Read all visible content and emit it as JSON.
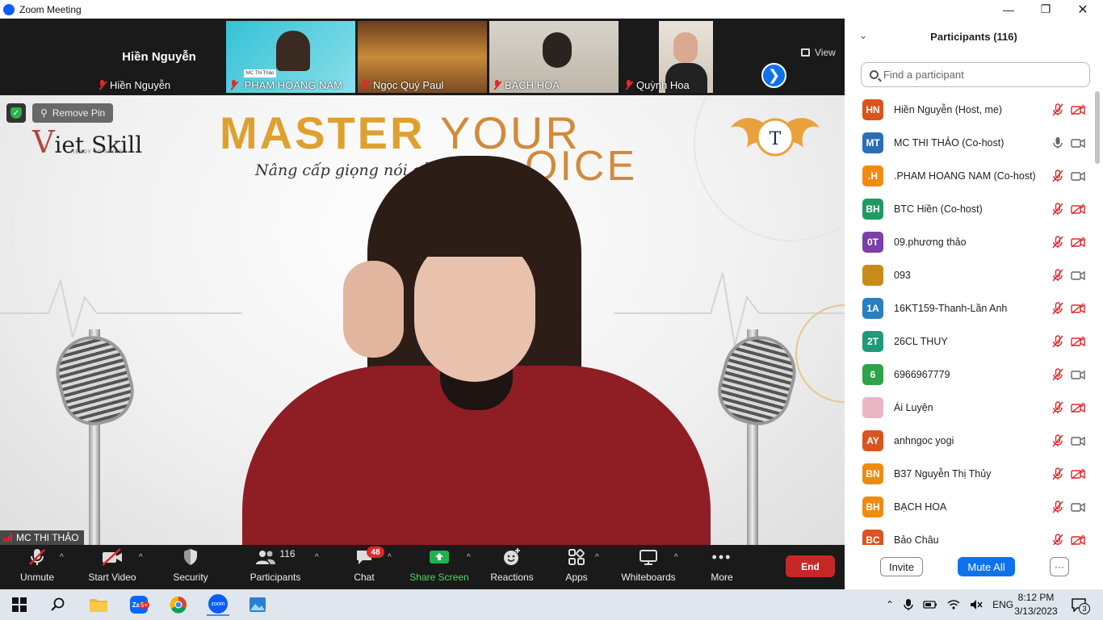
{
  "window": {
    "title": "Zoom Meeting"
  },
  "filmstrip": {
    "tiles": [
      {
        "name": "Hiền Nguyễn",
        "display_name": "Hiền Nguyễn"
      },
      {
        "name": ".PHAM HOANG NAM",
        "overlay_text": "MC Thi Thảo"
      },
      {
        "name": "Ngọc Quý Paul"
      },
      {
        "name": "BẠCH HOA"
      },
      {
        "name": "Quỳnh Hoa"
      }
    ],
    "view_label": "View"
  },
  "stage": {
    "brand": "iet Skill",
    "brand_letter": "V",
    "brand_sub": "READY TO SHINE !",
    "title_a": "MASTER ",
    "title_b": "YOUR",
    "title_c": "OICE",
    "subtitle": "Nâng cấp giọng nói của bạn",
    "remove_pin": "Remove Pin",
    "speaker_name": "MC THI THẢO"
  },
  "participants_panel": {
    "title": "Participants (116)",
    "search_placeholder": "Find a participant",
    "rows": [
      {
        "initials": "HN",
        "name": "Hiền Nguyễn (Host, me)",
        "color": "#d9541e",
        "mic": "muted",
        "cam": "off"
      },
      {
        "initials": "MT",
        "name": "MC THI THẢO (Co-host)",
        "color": "#2a6fb5",
        "mic": "on",
        "cam": "on"
      },
      {
        "initials": ".H",
        "name": ".PHAM HOANG NAM (Co-host)",
        "color": "#f08b12",
        "mic": "muted",
        "cam": "on"
      },
      {
        "initials": "BH",
        "name": "BTC Hiền (Co-host)",
        "color": "#1f9a63",
        "mic": "muted",
        "cam": "off"
      },
      {
        "initials": "0T",
        "name": "09.phương thảo",
        "color": "#7a3fa8",
        "mic": "muted",
        "cam": "off"
      },
      {
        "initials": "",
        "name": "093",
        "color": "#c98a1c",
        "mic": "muted",
        "cam": "on"
      },
      {
        "initials": "1A",
        "name": "16KT159-Thanh-Lần Anh",
        "color": "#2a7fc0",
        "mic": "muted",
        "cam": "off"
      },
      {
        "initials": "2T",
        "name": "26CL THUY",
        "color": "#1f9a7a",
        "mic": "muted",
        "cam": "off"
      },
      {
        "initials": "6",
        "name": "6966967779",
        "color": "#2fa34a",
        "mic": "muted",
        "cam": "on"
      },
      {
        "initials": "",
        "name": "Ái Luyện",
        "color": "#e8b7c3",
        "mic": "muted",
        "cam": "off"
      },
      {
        "initials": "AY",
        "name": "anhngoc yogi",
        "color": "#d9541e",
        "mic": "muted",
        "cam": "on"
      },
      {
        "initials": "BN",
        "name": "B37 Nguyễn Thị Thủy",
        "color": "#f08b12",
        "mic": "muted",
        "cam": "off"
      },
      {
        "initials": "BH",
        "name": "BẠCH HOA",
        "color": "#f08b12",
        "mic": "muted",
        "cam": "on"
      },
      {
        "initials": "BC",
        "name": "Bảo Châu",
        "color": "#d9541e",
        "mic": "muted",
        "cam": "off"
      }
    ],
    "invite_label": "Invite",
    "mute_all_label": "Mute All",
    "more_label": "···"
  },
  "toolbar": {
    "unmute": "Unmute",
    "start_video": "Start Video",
    "security": "Security",
    "participants": "Participants",
    "participants_count": "116",
    "chat": "Chat",
    "chat_badge": "48",
    "share_screen": "Share Screen",
    "reactions": "Reactions",
    "apps": "Apps",
    "whiteboards": "Whiteboards",
    "more": "More",
    "end": "End"
  },
  "taskbar": {
    "language": "ENG",
    "time": "8:12 PM",
    "date": "3/13/2023",
    "notification_count": "3",
    "zalo_badge": "5+"
  },
  "colors": {
    "accent": "#0e72ed",
    "end": "#c62828",
    "muted": "#e02828",
    "share": "#22b14c"
  }
}
